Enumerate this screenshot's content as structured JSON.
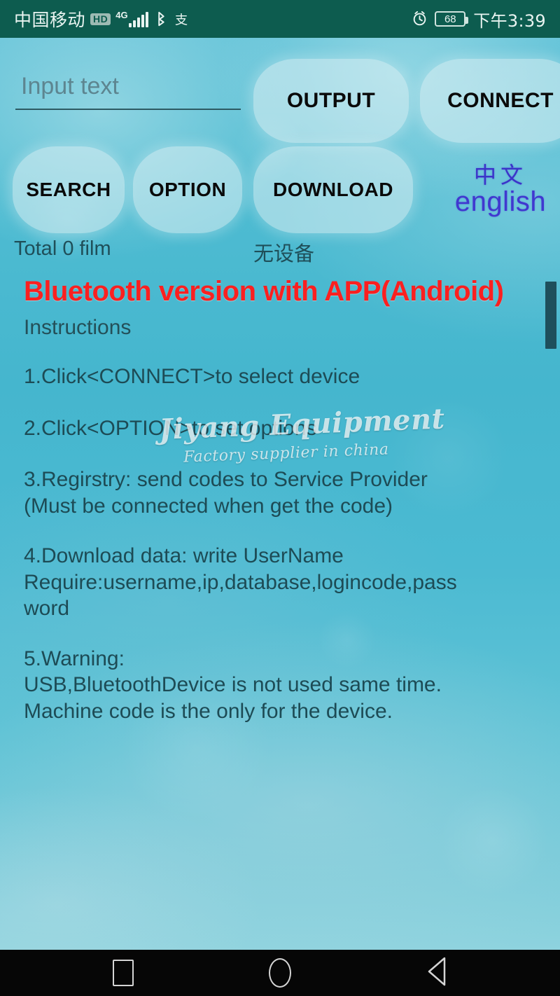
{
  "status_bar": {
    "carrier": "中国移动",
    "hd_badge": "HD",
    "network": "4G",
    "signal_icon": "signal-bars-icon",
    "bluetooth_icon": "bluetooth-icon",
    "alipay_icon": "alipay-icon",
    "alipay_glyph": "支",
    "alarm_icon": "alarm-clock-icon",
    "battery_level": "68",
    "time": "下午3:39"
  },
  "toolbar": {
    "input_placeholder": "Input text",
    "input_value": "",
    "output_label": "OUTPUT",
    "connect_label": "CONNECT",
    "search_label": "SEARCH",
    "option_label": "OPTION",
    "download_label": "DOWNLOAD",
    "lang_cn": "中文",
    "lang_en": "english"
  },
  "status_row": {
    "total_film": "Total 0 film",
    "device_status": "无设备"
  },
  "content": {
    "headline": "Bluetooth version with APP(Android)",
    "instructions_label": "Instructions",
    "steps": [
      "1.Click<CONNECT>to select device",
      "2.Click<OPTION>to set options",
      "3.Regirstry: send codes to Service Provider\n(Must be connected when get the code)",
      "4.Download data: write UserName\nRequire:username,ip,database,logincode,pass\nword",
      "5.Warning:\nUSB,BluetoothDevice is not used same time.\nMachine code is the only for the device."
    ]
  },
  "watermark": {
    "main": "Jiyang Equipment",
    "sub": "Factory supplier in china"
  },
  "nav_bar": {
    "recents_icon": "square-recents-icon",
    "home_icon": "circle-home-icon",
    "back_icon": "triangle-back-icon"
  },
  "colors": {
    "status_bar_bg": "#0d5c4f",
    "headline_red": "#fa2020",
    "body_text": "#1d4b55",
    "lang_blue": "#4038cf",
    "water_blue": "#4bbad2",
    "nav_bg": "#060606"
  }
}
